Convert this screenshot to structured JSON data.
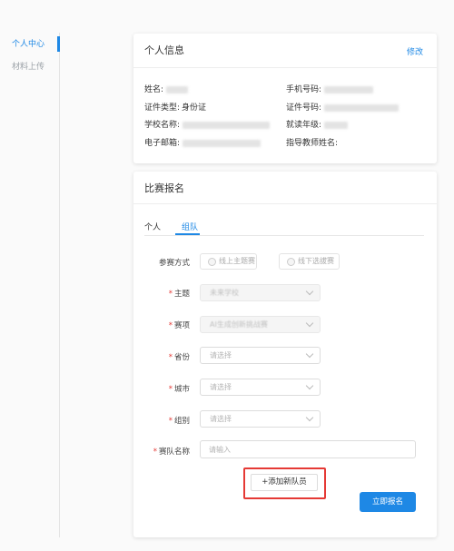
{
  "sidebar": {
    "items": [
      {
        "label": "个人中心",
        "active": true
      },
      {
        "label": "材料上传",
        "active": false
      }
    ]
  },
  "personal_info": {
    "title": "个人信息",
    "edit_label": "修改",
    "fields": {
      "name": {
        "label": "姓名:"
      },
      "phone": {
        "label": "手机号码:"
      },
      "id_type": {
        "label": "证件类型:",
        "value": "身份证"
      },
      "id_number": {
        "label": "证件号码:"
      },
      "school": {
        "label": "学校名称:"
      },
      "grade": {
        "label": "就读年级:"
      },
      "email": {
        "label": "电子邮箱:"
      },
      "teacher": {
        "label": "指导教师姓名:"
      }
    }
  },
  "registration": {
    "title": "比赛报名",
    "tabs": [
      {
        "label": "个人",
        "active": false
      },
      {
        "label": "组队",
        "active": true
      }
    ],
    "form": {
      "mode": {
        "label": "参赛方式",
        "options": [
          "线上主题赛",
          "线下选拔赛"
        ]
      },
      "theme": {
        "label": "主题",
        "value": "未来学校"
      },
      "track": {
        "label": "赛项",
        "value": "AI生成创新挑战赛"
      },
      "province": {
        "label": "省份",
        "placeholder": "请选择"
      },
      "city": {
        "label": "城市",
        "placeholder": "请选择"
      },
      "group": {
        "label": "组别",
        "placeholder": "请选择"
      },
      "team_name": {
        "label": "赛队名称",
        "placeholder": "请输入"
      },
      "required_mark": "*"
    },
    "add_member_label": "+添加新队员",
    "submit_label": "立即报名"
  },
  "colors": {
    "accent": "#1e88e5",
    "highlight": "#e53935"
  }
}
